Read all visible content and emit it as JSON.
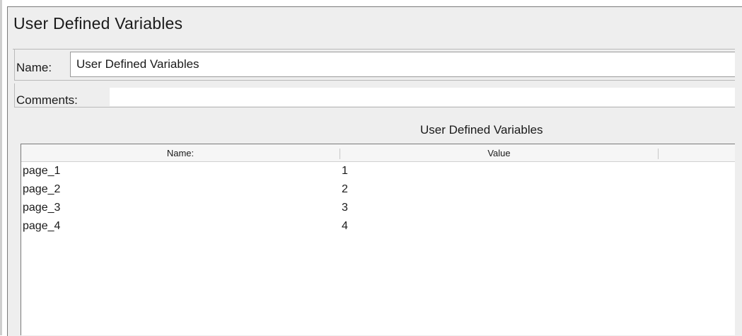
{
  "panel": {
    "title": "User Defined Variables"
  },
  "form": {
    "name_label": "Name:",
    "name_value": "User Defined Variables",
    "comments_label": "Comments:",
    "comments_value": ""
  },
  "table": {
    "caption": "User Defined Variables",
    "columns": [
      "Name:",
      "Value"
    ],
    "rows": [
      {
        "name": "page_1",
        "value": "1"
      },
      {
        "name": "page_2",
        "value": "2"
      },
      {
        "name": "page_3",
        "value": "3"
      },
      {
        "name": "page_4",
        "value": "4"
      }
    ]
  }
}
